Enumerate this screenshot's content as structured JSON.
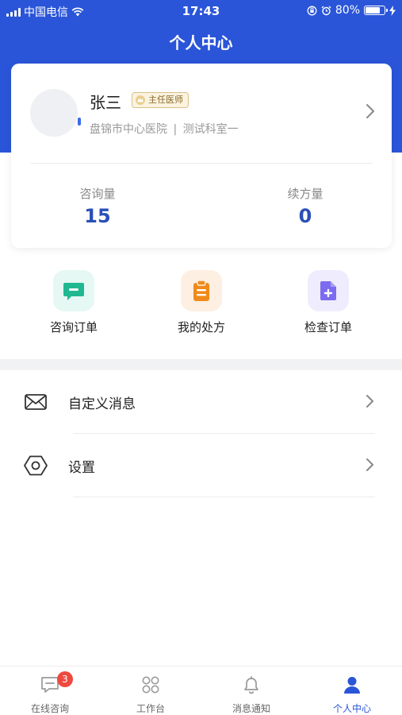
{
  "status_bar": {
    "carrier": "中国电信",
    "time": "17:43",
    "battery_percent": 80
  },
  "header": {
    "title": "个人中心"
  },
  "profile": {
    "name": "张三",
    "title_badge": "主任医师",
    "hospital": "盘锦市中心医院",
    "separator": "|",
    "department": "测试科室一",
    "stats": [
      {
        "label": "咨询量",
        "value": "15"
      },
      {
        "label": "续方量",
        "value": "0"
      }
    ]
  },
  "shortcuts": [
    {
      "label": "咨询订单",
      "icon": "chat-icon",
      "color": "#20b890",
      "bg": "#e6f8f3"
    },
    {
      "label": "我的处方",
      "icon": "clipboard-icon",
      "color": "#f08a1c",
      "bg": "#fdf0e2"
    },
    {
      "label": "检查订单",
      "icon": "document-plus-icon",
      "color": "#7b6cf0",
      "bg": "#efedfd"
    }
  ],
  "menu": [
    {
      "label": "自定义消息",
      "icon": "envelope-icon"
    },
    {
      "label": "设置",
      "icon": "hexagon-settings-icon"
    }
  ],
  "tabbar": [
    {
      "label": "在线咨询",
      "icon": "chat-bubble-icon",
      "badge": "3",
      "active": false
    },
    {
      "label": "工作台",
      "icon": "grid-icon",
      "active": false
    },
    {
      "label": "消息通知",
      "icon": "bell-icon",
      "active": false
    },
    {
      "label": "个人中心",
      "icon": "person-icon",
      "active": true
    }
  ],
  "colors": {
    "brand": "#2a55d8",
    "stat_value": "#2a4fb8",
    "badge_red": "#ee4a3f"
  }
}
